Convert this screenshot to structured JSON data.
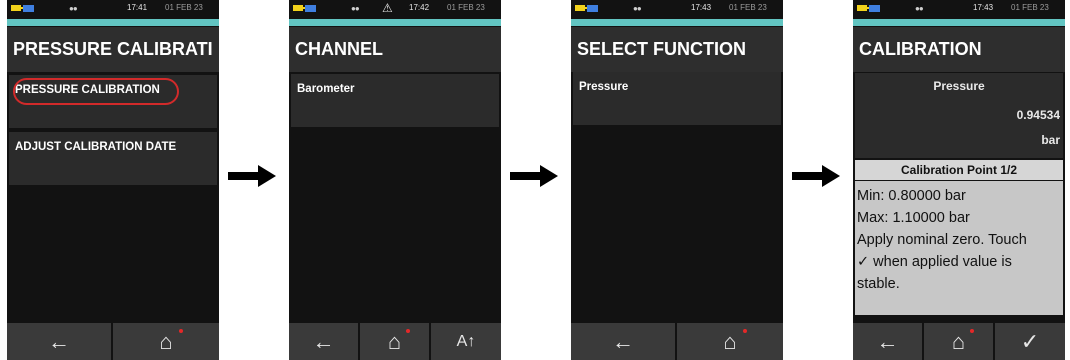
{
  "colors": {
    "accent_teal": "#62c5c2",
    "highlight_red": "#d22a2a",
    "battery": "#f2d21b",
    "status_blue": "#3f7fe0"
  },
  "screens": [
    {
      "status": {
        "time": "17:41",
        "date": "01 FEB 23",
        "warning": ""
      },
      "title": "PRESSURE CALIBRATI",
      "items": [
        "PRESSURE CALIBRATION",
        "ADJUST CALIBRATION DATE"
      ],
      "nav": [
        "back-arrow-icon",
        "home-icon"
      ]
    },
    {
      "status": {
        "time": "17:42",
        "date": "01 FEB 23",
        "warning": "⚠"
      },
      "title": "CHANNEL",
      "items": [
        "Barometer"
      ],
      "nav": [
        "back-arrow-icon",
        "home-icon",
        "sort-az-icon"
      ]
    },
    {
      "status": {
        "time": "17:43",
        "date": "01 FEB 23",
        "warning": ""
      },
      "title": "SELECT FUNCTION",
      "items": [
        "Pressure"
      ],
      "nav": [
        "back-arrow-icon",
        "home-icon"
      ]
    },
    {
      "status": {
        "time": "17:43",
        "date": "01 FEB 23",
        "warning": ""
      },
      "title": "CALIBRATION",
      "reading": {
        "label": "Pressure",
        "value": "0.94534",
        "unit": "bar"
      },
      "point_label": "Calibration Point 1/2",
      "instructions": [
        "Min: 0.80000 bar",
        "Max: 1.10000 bar",
        "Apply nominal zero. Touch",
        "✓ when applied value is",
        "stable."
      ],
      "nav": [
        "back-arrow-icon",
        "home-icon",
        "checkmark-icon"
      ]
    }
  ],
  "glyphs": {
    "back": "←",
    "home": "⌂",
    "sort": "A↑",
    "check": "✓"
  }
}
